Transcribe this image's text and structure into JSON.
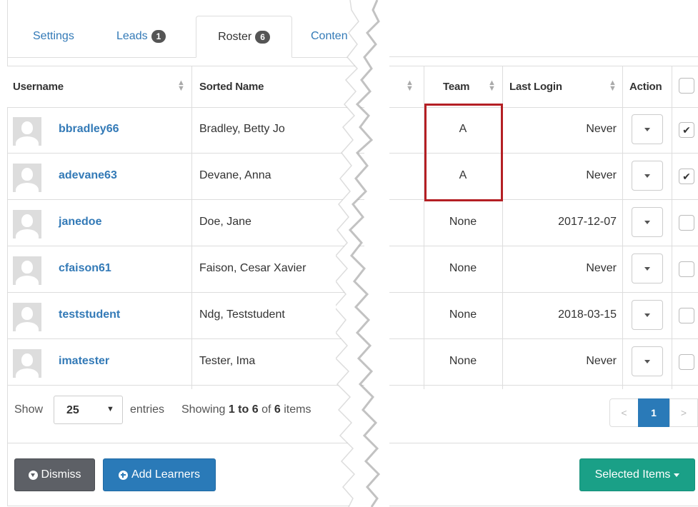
{
  "tabs": [
    {
      "label": "Settings"
    },
    {
      "label": "Leads",
      "badge": "1"
    },
    {
      "label": "Roster",
      "badge": "6"
    },
    {
      "label": "Conten"
    }
  ],
  "table": {
    "headers": {
      "username": "Username",
      "sorted_name": "Sorted Name",
      "team": "Team",
      "last_login": "Last Login",
      "action": "Action"
    },
    "rows": [
      {
        "username": "bbradley66",
        "sorted_name": "Bradley, Betty Jo",
        "team": "A",
        "last_login": "Never",
        "checked": true
      },
      {
        "username": "adevane63",
        "sorted_name": "Devane, Anna",
        "team": "A",
        "last_login": "Never",
        "checked": true
      },
      {
        "username": "janedoe",
        "sorted_name": "Doe, Jane",
        "team": "None",
        "last_login": "2017-12-07",
        "checked": false
      },
      {
        "username": "cfaison61",
        "sorted_name": "Faison, Cesar Xavier",
        "team": "None",
        "last_login": "Never",
        "checked": false
      },
      {
        "username": "teststudent",
        "sorted_name": "Ndg, Teststudent",
        "team": "None",
        "last_login": "2018-03-15",
        "checked": false
      },
      {
        "username": "imatester",
        "sorted_name": "Tester, Ima",
        "team": "None",
        "last_login": "Never",
        "checked": false
      }
    ]
  },
  "footer": {
    "show_label": "Show",
    "page_size": "25",
    "entries_label": "entries",
    "showing_prefix": "Showing",
    "showing_range": "1 to 6",
    "showing_of": "of",
    "showing_total": "6",
    "showing_suffix": "items"
  },
  "pagination": {
    "prev": "<",
    "current": "1",
    "next": ">"
  },
  "buttons": {
    "dismiss": "Dismiss",
    "add_learners": "Add Learners",
    "selected_items": "Selected Items"
  },
  "colors": {
    "link": "#337ab7",
    "primary": "#2a7ab8",
    "success": "#1aa087",
    "dismiss": "#5d6066",
    "highlight": "#b41f24"
  }
}
